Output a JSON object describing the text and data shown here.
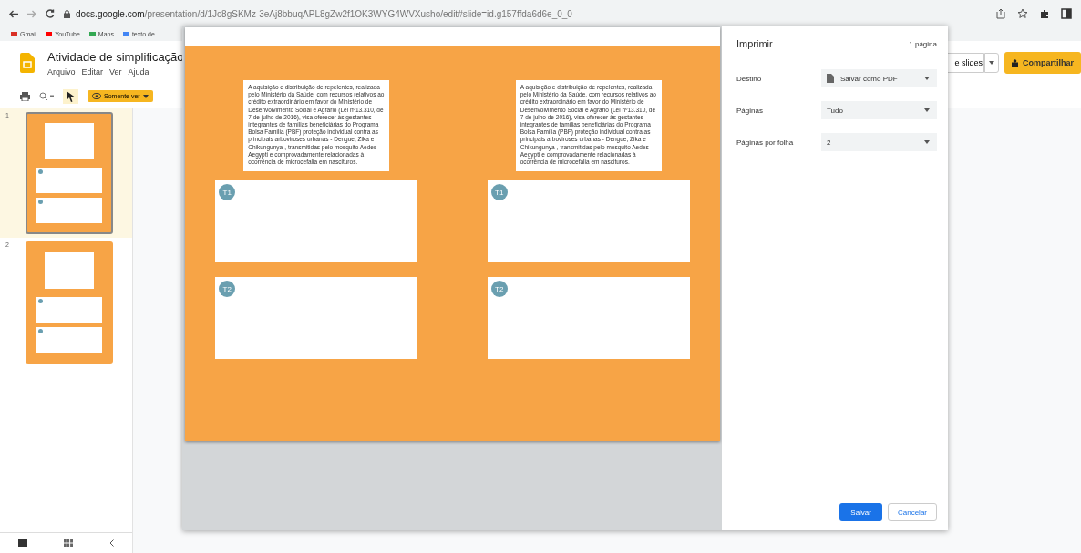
{
  "browser": {
    "url_host": "docs.google.com",
    "url_path": "/presentation/d/1Jc8gSKMz-3eAj8bbuqAPL8gZw2f1OK3WYG4WVXusho/edit#slide=id.g157ffda6d6e_0_0"
  },
  "bookmarks": [
    {
      "label": "Gmail",
      "kind": "gmail"
    },
    {
      "label": "YouTube",
      "kind": "youtube"
    },
    {
      "label": "Maps",
      "kind": "maps"
    },
    {
      "label": "texto de",
      "kind": "google"
    }
  ],
  "app": {
    "title": "Atividade de simplificação",
    "menus": [
      "Arquivo",
      "Editar",
      "Ver",
      "Ajuda"
    ],
    "mode_button": "Somente ver",
    "present_button": "e slides",
    "share_button": "Compartilhar"
  },
  "thumbnails": [
    {
      "number": "1",
      "selected": true
    },
    {
      "number": "2",
      "selected": false
    }
  ],
  "preview": {
    "slides": [
      {
        "text": "A aquisição e distribuição de repelentes, realizada pelo Ministério da Saúde, com recursos relativos ao crédito extraordinário em favor do Ministério de Desenvolvimento Social e Agrário (Lei nº13.310, de 7 de julho de 2016), visa oferecer às gestantes integrantes de famílias beneficiárias do Programa Bolsa Família (PBF) proteção individual contra as principais arboviroses urbanas - Dengue, Zika e Chikungunya-, transmitidas pelo mosquito Aedes Aegypti e comprovadamente relacionadas à ocorrência de microcefalia em nascituros.",
        "boxes": [
          "T1",
          "T2"
        ]
      },
      {
        "text": "A aquisição e distribuição de repelentes, realizada pelo Ministério da Saúde, com recursos relativos ao crédito extraordinário em favor do Ministério de Desenvolvimento Social e Agrário (Lei nº13.310, de 7 de julho de 2016), visa oferecer às gestantes integrantes de famílias beneficiárias do Programa Bolsa Família (PBF) proteção individual contra as principais arboviroses urbanas - Dengue, Zika e Chikungunya-, transmitidas pelo mosquito Aedes Aegypti e comprovadamente relacionadas à ocorrência de microcefalia em nascituros.",
        "boxes": [
          "T1",
          "T2"
        ]
      }
    ]
  },
  "print": {
    "title": "Imprimir",
    "page_count": "1 página",
    "settings": [
      {
        "label": "Destino",
        "value": "Salvar como PDF",
        "kind": "file"
      },
      {
        "label": "Páginas",
        "value": "Tudo",
        "kind": "plain"
      },
      {
        "label": "Páginas por folha",
        "value": "2",
        "kind": "plain"
      }
    ],
    "save_button": "Salvar",
    "cancel_button": "Cancelar"
  }
}
